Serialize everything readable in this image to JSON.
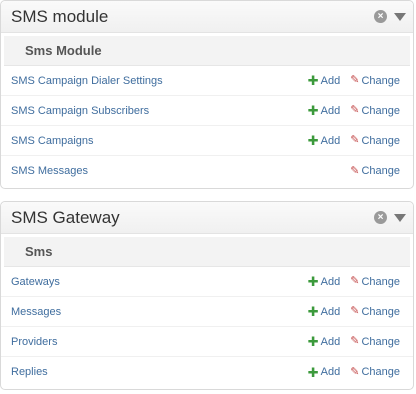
{
  "modules": [
    {
      "title": "SMS module",
      "subheader": "Sms Module",
      "rows": [
        {
          "label": "SMS Campaign Dialer Settings",
          "add": "Add",
          "change": "Change"
        },
        {
          "label": "SMS Campaign Subscribers",
          "add": "Add",
          "change": "Change"
        },
        {
          "label": "SMS Campaigns",
          "add": "Add",
          "change": "Change"
        },
        {
          "label": "SMS Messages",
          "change": "Change"
        }
      ]
    },
    {
      "title": "SMS Gateway",
      "subheader": "Sms",
      "rows": [
        {
          "label": "Gateways",
          "add": "Add",
          "change": "Change"
        },
        {
          "label": "Messages",
          "add": "Add",
          "change": "Change"
        },
        {
          "label": "Providers",
          "add": "Add",
          "change": "Change"
        },
        {
          "label": "Replies",
          "add": "Add",
          "change": "Change"
        }
      ]
    }
  ],
  "icons": {
    "add": "plus-icon",
    "change": "pencil-icon",
    "close": "close-icon",
    "collapse": "chevron-down-icon"
  },
  "colors": {
    "link": "#3f6d9e",
    "add_icon": "#3c9a3c",
    "change_icon": "#c34a4a"
  }
}
